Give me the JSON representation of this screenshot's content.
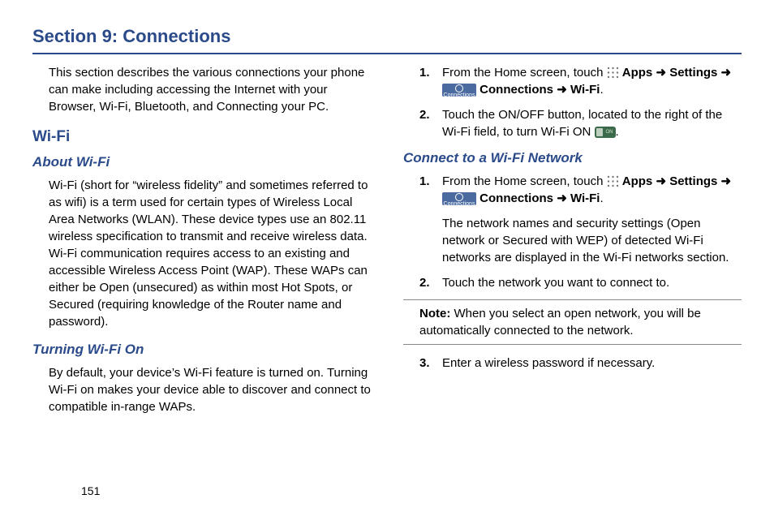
{
  "section_title": "Section 9: Connections",
  "page_number": "151",
  "col1": {
    "intro": "This section describes the various connections your phone can make including accessing the Internet with your Browser, Wi-Fi, Bluetooth, and Connecting your PC.",
    "h2_wifi": "Wi-Fi",
    "h3_about": "About Wi-Fi",
    "about_para": "Wi-Fi (short for “wireless fidelity” and sometimes referred to as wifi) is a term used for certain types of Wireless Local Area Networks (WLAN). These device types use an 802.11 wireless specification to transmit and receive wireless data. Wi-Fi communication requires access to an existing and accessible Wireless Access Point (WAP). These WAPs can either be Open (unsecured) as within most Hot Spots, or Secured (requiring knowledge of the Router name and password).",
    "h3_turning": "Turning Wi-Fi On",
    "turning_para": "By default, your device’s Wi-Fi feature is turned on. Turning Wi-Fi on makes your device able to discover and connect to compatible in-range WAPs."
  },
  "col2": {
    "step1_num": "1.",
    "step1_prefix": "From the Home screen, touch ",
    "apps": "Apps",
    "arrow": " ➜ ",
    "settings": "Settings",
    "connections": "Connections",
    "wifi": "Wi-Fi",
    "step2_num": "2.",
    "step2_a": "Touch the ON/OFF button, located to the right of the Wi-Fi field, to turn Wi-Fi ON ",
    "period": ".",
    "h3_connect": "Connect to a Wi-Fi Network",
    "c_step1_num": "1.",
    "c_step1_sub": "The network names and security settings (Open network or Secured with WEP) of detected Wi-Fi networks are displayed in the Wi-Fi networks section.",
    "c_step2_num": "2.",
    "c_step2_txt": "Touch the network you want to connect to.",
    "note_label": "Note:",
    "note_body": " When you select an open network, you will be automatically connected to the network.",
    "c_step3_num": "3.",
    "c_step3_txt": "Enter a wireless password if necessary."
  }
}
